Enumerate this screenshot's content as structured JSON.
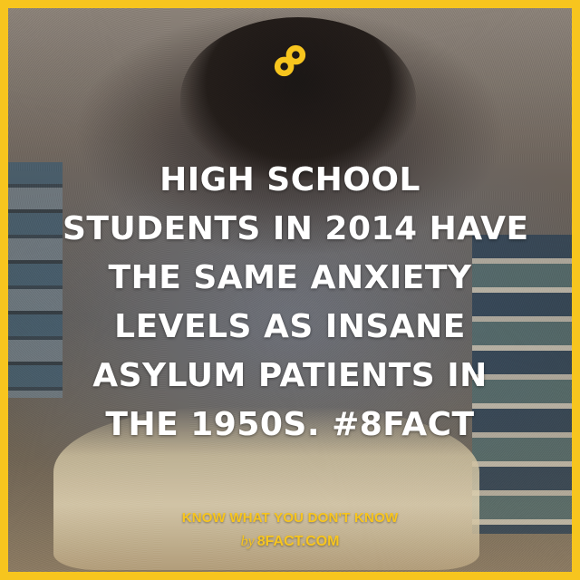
{
  "brand": {
    "accent_color": "#f7c51e",
    "logo_icon": "infinity-8-icon"
  },
  "headline": {
    "lines": [
      "HIGH SCHOOL",
      "STUDENTS IN 2014 HAVE",
      "THE SAME ANXIETY",
      "LEVELS AS INSANE",
      "ASYLUM PATIENTS IN",
      "THE 1950S. #8FACT"
    ]
  },
  "footer": {
    "tagline": "KNOW WHAT YOU DON'T KNOW",
    "by_prefix": "by",
    "site": "8FACT.COM"
  }
}
